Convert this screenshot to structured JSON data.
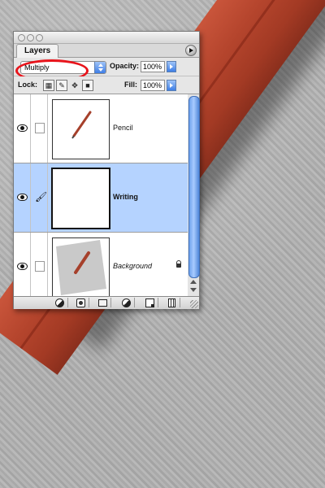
{
  "panel": {
    "tab_label": "Layers"
  },
  "blend": {
    "mode": "Multiply"
  },
  "opacity": {
    "label": "Opacity:",
    "value": "100%"
  },
  "lock": {
    "label": "Lock:"
  },
  "fill": {
    "label": "Fill:",
    "value": "100%"
  },
  "layers": [
    {
      "name": "Pencil",
      "visible": true,
      "selected": false,
      "style": "normal"
    },
    {
      "name": "Writing",
      "visible": true,
      "selected": true,
      "style": "bold"
    },
    {
      "name": "Background",
      "visible": true,
      "selected": false,
      "style": "italic",
      "locked": true
    }
  ],
  "colors": {
    "selection": "#b5d3ff",
    "annotation_red": "#e8141b",
    "pencil_red": "#b5452d"
  }
}
